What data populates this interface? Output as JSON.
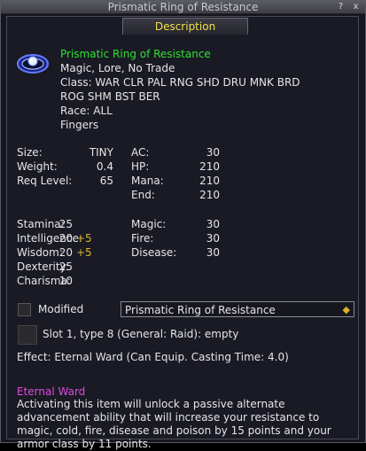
{
  "window": {
    "title": "Prismatic Ring of Resistance",
    "help_label": "?",
    "close_label": "x"
  },
  "tab": {
    "label": "Description"
  },
  "item": {
    "name": "Prismatic Ring of Resistance",
    "flags": "Magic, Lore, No Trade",
    "class_line1": "Class: WAR CLR PAL RNG SHD DRU MNK BRD",
    "class_line2": "ROG SHM BST BER",
    "race": "Race: ALL",
    "slot": "Fingers"
  },
  "stats_left": [
    {
      "label": "Size:",
      "value": "TINY"
    },
    {
      "label": "Weight:",
      "value": "0.4"
    },
    {
      "label": "Req Level:",
      "value": "65"
    }
  ],
  "stats_right": [
    {
      "label": "AC:",
      "value": "30"
    },
    {
      "label": "HP:",
      "value": "210"
    },
    {
      "label": "Mana:",
      "value": "210"
    },
    {
      "label": "End:",
      "value": "210"
    }
  ],
  "attrs": [
    {
      "label": "Stamina:",
      "value": "25",
      "bonus": ""
    },
    {
      "label": "Intelligence:",
      "value": "20",
      "bonus": "+5"
    },
    {
      "label": "Wisdom:",
      "value": "20",
      "bonus": "+5"
    },
    {
      "label": "Dexterity:",
      "value": "25",
      "bonus": ""
    },
    {
      "label": "Charisma:",
      "value": "10",
      "bonus": ""
    }
  ],
  "resists": [
    {
      "label": "Magic:",
      "value": "30"
    },
    {
      "label": "Fire:",
      "value": "30"
    },
    {
      "label": "Disease:",
      "value": "30"
    }
  ],
  "modified": {
    "label": "Modified",
    "selected": "Prismatic Ring of Resistance"
  },
  "augment_slot": {
    "text": "Slot 1, type 8 (General: Raid): empty"
  },
  "effect": {
    "text": "Effect: Eternal Ward (Can Equip. Casting Time: 4.0)"
  },
  "effect_desc": {
    "title": "Eternal Ward",
    "body": "Activating this item will unlock a passive alternate advancement ability that will increase your resistance to magic, cold, fire, disease and poison by 15 points and your armor class by 11 points."
  },
  "colors": {
    "name_green": "#2fe02f",
    "bonus_gold": "#e0b22a",
    "tab_yellow": "#f2e04a",
    "effect_purple": "#e04be0"
  },
  "icons": {
    "item_icon": "prismatic-ring-icon",
    "dropdown_arrow": "diamond-arrow-icon"
  }
}
